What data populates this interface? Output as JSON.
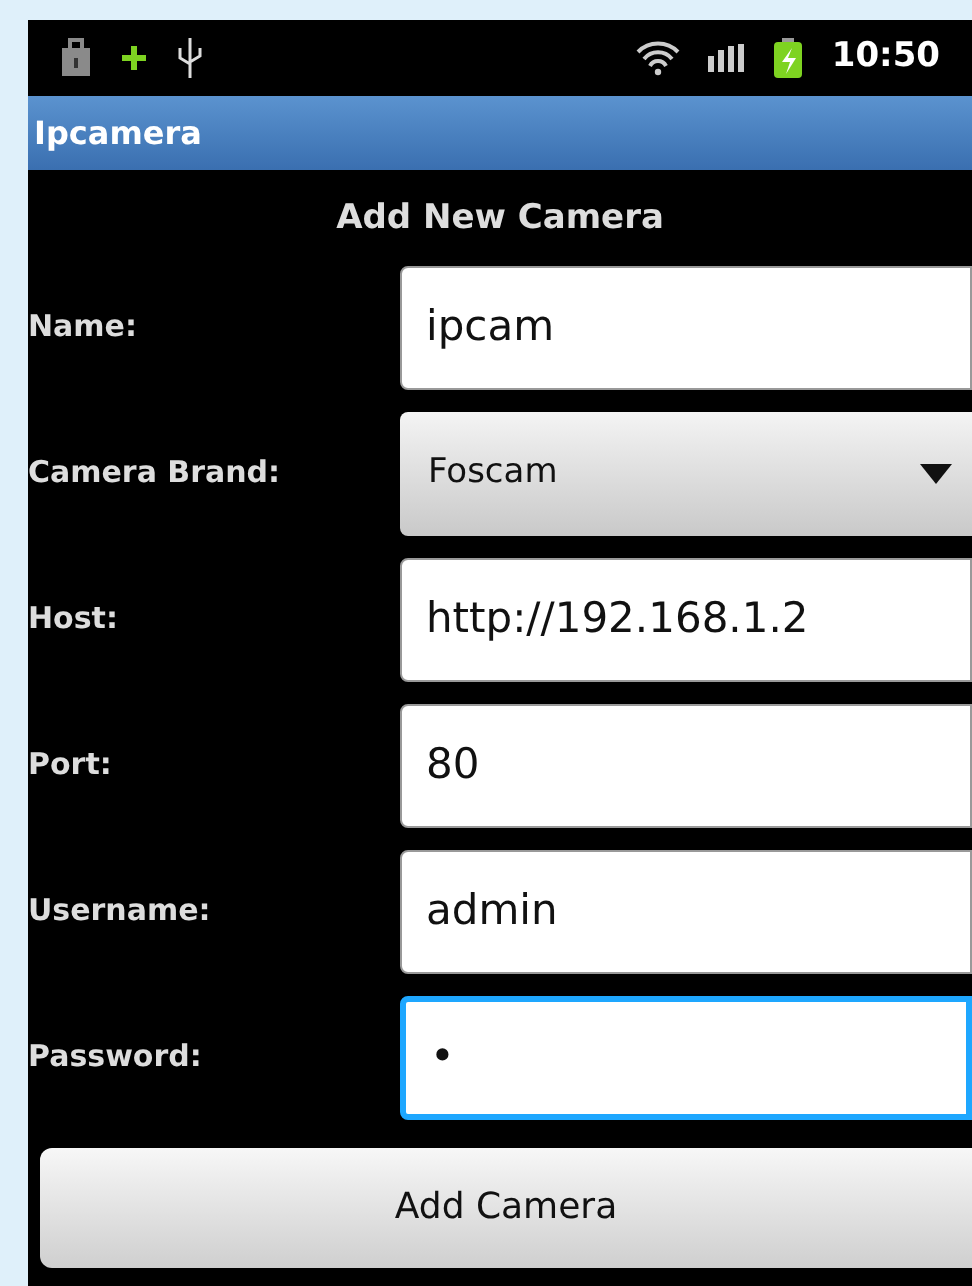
{
  "status_bar": {
    "time": "10:50"
  },
  "app_bar": {
    "title": "Ipcamera"
  },
  "heading": "Add New Camera",
  "fields": [
    {
      "label": "Name:",
      "kind": "text",
      "value": "ipcam",
      "focused": false
    },
    {
      "label": "Camera Brand:",
      "kind": "spinner",
      "value": "Foscam",
      "focused": false
    },
    {
      "label": "Host:",
      "kind": "text",
      "value": "http://192.168.1.2",
      "focused": false
    },
    {
      "label": "Port:",
      "kind": "text",
      "value": "80",
      "focused": false
    },
    {
      "label": "Username:",
      "kind": "text",
      "value": "admin",
      "focused": false
    },
    {
      "label": "Password:",
      "kind": "text",
      "value": "•",
      "focused": true
    }
  ],
  "button": "Add Camera"
}
